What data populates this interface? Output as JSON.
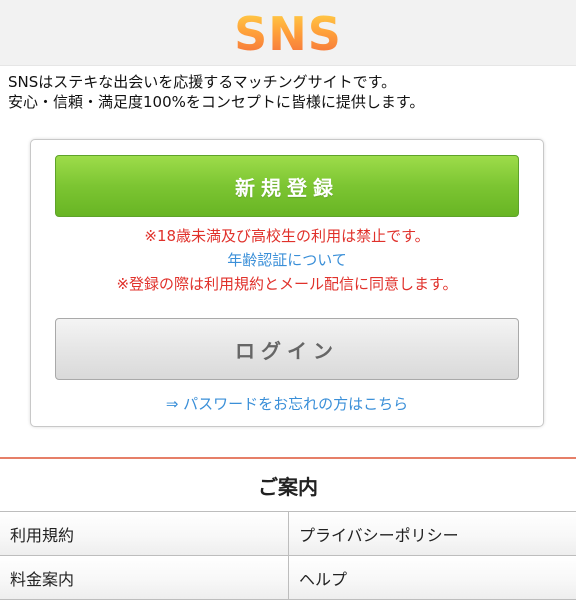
{
  "header": {
    "logo_text": "SNS"
  },
  "intro": {
    "line1": "SNSはステキな出会いを応援するマッチングサイトです。",
    "line2": "安心・信頼・満足度100%をコンセプトに皆様に提供します。"
  },
  "panel": {
    "register_label": "新規登録",
    "age_notice": "※18歳未満及び高校生の利用は禁止です。",
    "age_verification_link": "年齢認証について",
    "terms_notice": "※登録の際は利用規約とメール配信に同意します。",
    "login_label": "ログイン",
    "forgot_password_link": "⇒ パスワードをお忘れの方はこちら"
  },
  "guide": {
    "title": "ご案内",
    "items": [
      {
        "label": "利用規約"
      },
      {
        "label": "プライバシーポリシー"
      },
      {
        "label": "料金案内"
      },
      {
        "label": "ヘルプ"
      }
    ]
  },
  "colors": {
    "register_green": "#7cc532",
    "notice_red": "#e0312b",
    "link_blue": "#3a8fd8",
    "divider_orange": "#e67f68"
  }
}
